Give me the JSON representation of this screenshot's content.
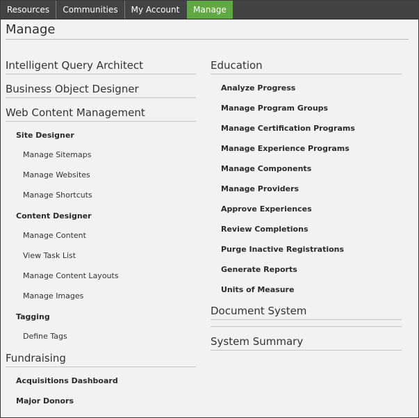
{
  "tabs": {
    "resources": "Resources",
    "communities": "Communities",
    "my_account": "My Account",
    "manage": "Manage"
  },
  "page_title": "Manage",
  "left": {
    "iqa": "Intelligent Query Architect",
    "bod": "Business Object Designer",
    "wcm": {
      "title": "Web Content Management",
      "site_designer": {
        "title": "Site Designer",
        "items": [
          "Manage Sitemaps",
          "Manage Websites",
          "Manage Shortcuts"
        ]
      },
      "content_designer": {
        "title": "Content Designer",
        "items": [
          "Manage Content",
          "View Task List",
          "Manage Content Layouts",
          "Manage Images"
        ]
      },
      "tagging": {
        "title": "Tagging",
        "items": [
          "Define Tags"
        ]
      }
    },
    "fundraising": {
      "title": "Fundraising",
      "items": [
        "Acquisitions Dashboard",
        "Major Donors"
      ]
    }
  },
  "right": {
    "education": {
      "title": "Education",
      "items": [
        "Analyze Progress",
        "Manage Program Groups",
        "Manage Certification Programs",
        "Manage Experience Programs",
        "Manage Components",
        "Manage Providers",
        "Approve Experiences",
        "Review Completions",
        "Purge Inactive Registrations",
        "Generate Reports",
        "Units of Measure"
      ]
    },
    "document_system": "Document System",
    "system_summary": "System Summary"
  }
}
